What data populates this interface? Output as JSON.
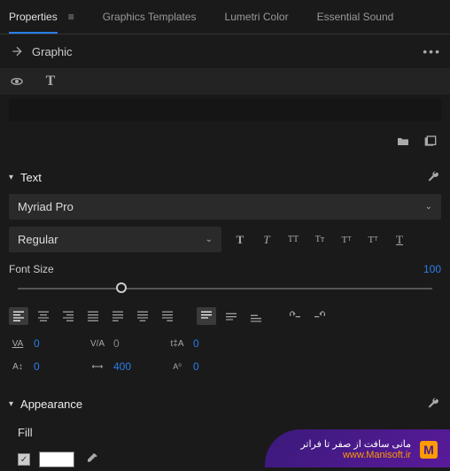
{
  "tabs": {
    "properties": "Properties",
    "graphics_templates": "Graphics Templates",
    "lumetri_color": "Lumetri Color",
    "essential_sound": "Essential Sound"
  },
  "graphic": {
    "label": "Graphic"
  },
  "text": {
    "label": "Text",
    "font_family": "Myriad Pro",
    "font_style": "Regular",
    "font_size_label": "Font Size",
    "font_size_value": "100",
    "tracking": "0",
    "kerning": "0",
    "leading": "0",
    "baseline_shift": "0",
    "tsume": "400",
    "other_metric": "0"
  },
  "appearance": {
    "label": "Appearance",
    "fill_label": "Fill",
    "fill_color": "#ffffff",
    "fill_enabled": true
  },
  "watermark": {
    "line1": "مانی سافت از صفر تا فراتر",
    "line2": "www.Manisoft.ir",
    "logo": "M"
  }
}
